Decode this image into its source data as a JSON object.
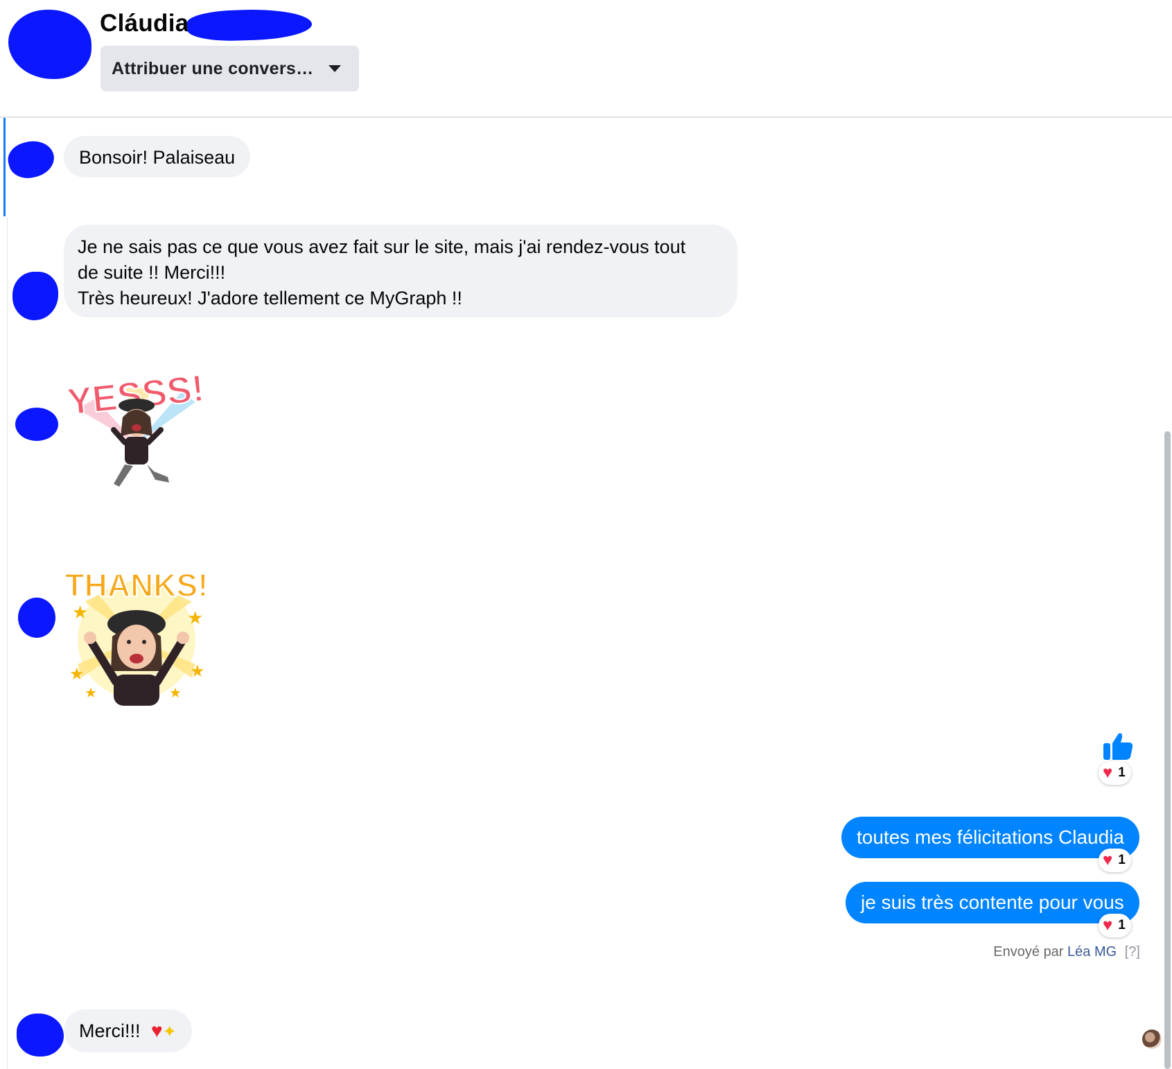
{
  "header": {
    "contact_name": "Cláudia",
    "assign_label": "Attribuer une convers…"
  },
  "messages": {
    "m1": "Bonsoir! Palaiseau",
    "m2_lines": [
      "Je ne sais pas ce que vous avez fait sur le site, mais j'ai rendez-vous tout",
      "de suite !!  Merci!!!",
      "Très heureux!  J'adore tellement ce MyGraph !!"
    ],
    "sticker1_text": "YESSS!",
    "sticker2_text": "THANKS!",
    "out1": "toutes mes félicitations Claudia",
    "out2": "je suis très contente pour vous",
    "m3": "Merci!!!"
  },
  "reactions": {
    "like_count": "1",
    "out1_count": "1",
    "out2_count": "1"
  },
  "sent_by": {
    "prefix": "Envoyé par",
    "name": "Léa MG",
    "help": "[?]"
  },
  "colors": {
    "outgoing_bubble": "#0084ff",
    "incoming_bubble": "#f0f2f5",
    "heart": "#f02849",
    "like_icon": "#0084ff",
    "redaction": "#0a17ff"
  }
}
